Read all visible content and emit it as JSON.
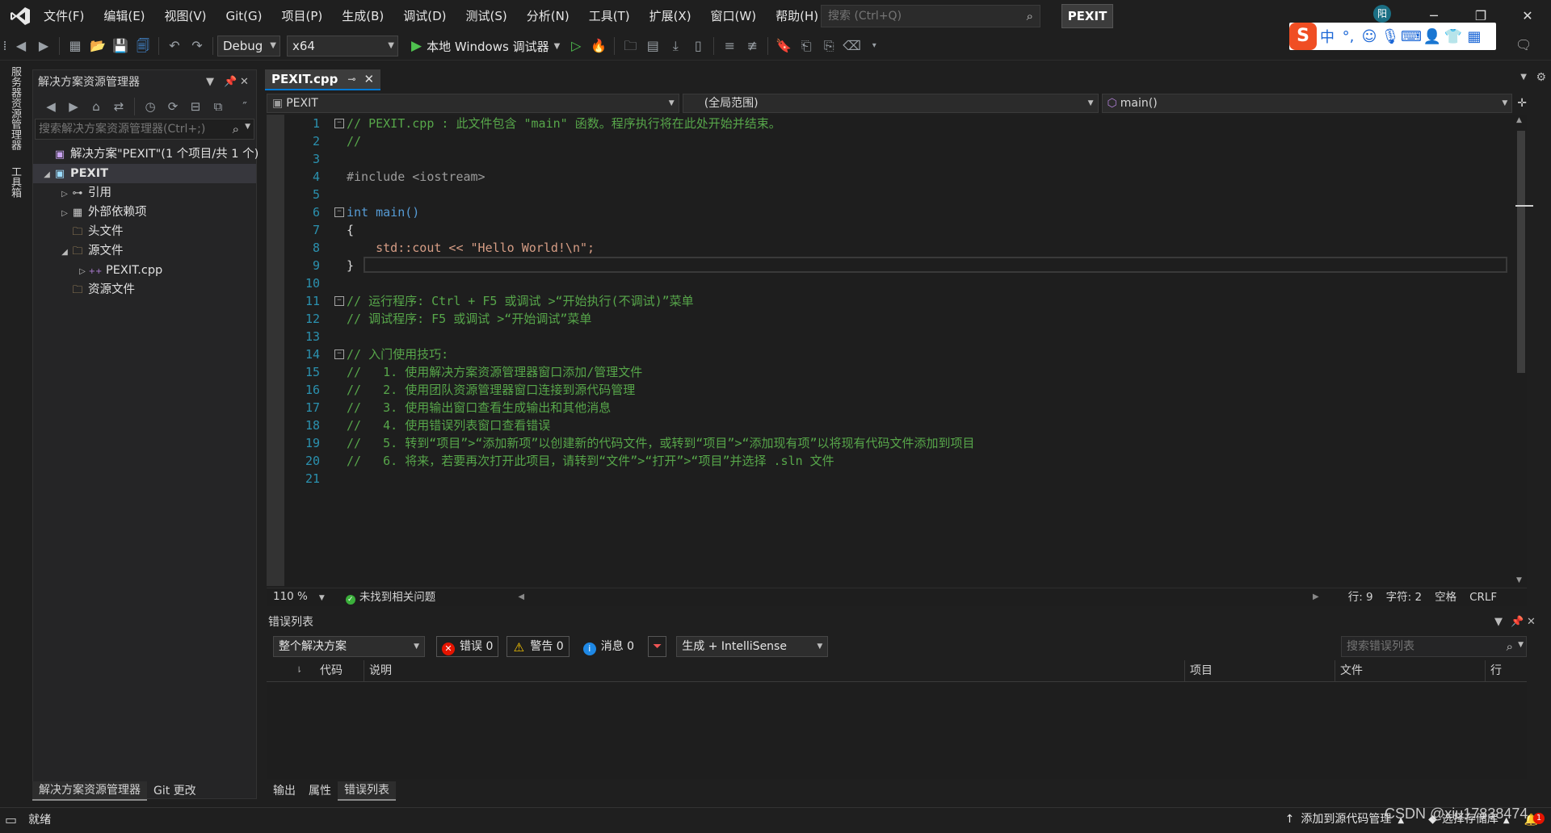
{
  "menu": [
    "文件(F)",
    "编辑(E)",
    "视图(V)",
    "Git(G)",
    "项目(P)",
    "生成(B)",
    "调试(D)",
    "测试(S)",
    "分析(N)",
    "工具(T)",
    "扩展(X)",
    "窗口(W)",
    "帮助(H)"
  ],
  "search": {
    "placeholder": "搜索 (Ctrl+Q)"
  },
  "solution_badge": "PEXIT",
  "account_initial": "阳",
  "toolbar": {
    "config": "Debug",
    "platform": "x64",
    "run_label": "本地 Windows 调试器"
  },
  "ime": {
    "logo": "S",
    "mode": "中",
    "punct": "°,"
  },
  "left_strip": [
    "服务器资源管理器",
    "工具箱"
  ],
  "solution_explorer": {
    "title": "解决方案资源管理器",
    "search_placeholder": "搜索解决方案资源管理器(Ctrl+;)",
    "tree": [
      {
        "label": "解决方案\"PEXIT\"(1 个项目/共 1 个)",
        "level": 0,
        "exp": "",
        "icon": "solution-icon"
      },
      {
        "label": "PEXIT",
        "level": 0,
        "exp": "◢",
        "icon": "project-icon"
      },
      {
        "label": "引用",
        "level": 1,
        "exp": "▷",
        "icon": "reference-icon"
      },
      {
        "label": "外部依赖项",
        "level": 1,
        "exp": "▷",
        "icon": "dependency-icon"
      },
      {
        "label": "头文件",
        "level": 1,
        "exp": "",
        "icon": "folder-icon"
      },
      {
        "label": "源文件",
        "level": 1,
        "exp": "◢",
        "icon": "folder-icon"
      },
      {
        "label": "PEXIT.cpp",
        "level": 2,
        "exp": "▷",
        "icon": "cpp-file-icon"
      },
      {
        "label": "资源文件",
        "level": 1,
        "exp": "",
        "icon": "folder-icon"
      }
    ],
    "bottom_tabs": [
      "解决方案资源管理器",
      "Git 更改"
    ]
  },
  "editor": {
    "tab": "PEXIT.cpp",
    "nav": {
      "project": "PEXIT",
      "scope": "(全局范围)",
      "member": "main()"
    },
    "lines": [
      {
        "n": "1",
        "fold": "⊟",
        "t": "// PEXIT.cpp : 此文件包含 \"main\" 函数。程序执行将在此处开始并结束。",
        "c": "cm"
      },
      {
        "n": "2",
        "fold": "",
        "t": "//",
        "c": "cm"
      },
      {
        "n": "3",
        "fold": "",
        "t": "",
        "c": "txt"
      },
      {
        "n": "4",
        "fold": "",
        "t": "#include <iostream>",
        "c": "pp"
      },
      {
        "n": "5",
        "fold": "",
        "t": "",
        "c": "txt"
      },
      {
        "n": "6",
        "fold": "⊟",
        "t": "int main()",
        "c": "mix-main"
      },
      {
        "n": "7",
        "fold": "",
        "t": "{",
        "c": "txt"
      },
      {
        "n": "8",
        "fold": "",
        "t": "    std::cout << \"Hello World!\\n\";",
        "c": "mix-cout"
      },
      {
        "n": "9",
        "fold": "",
        "t": "}",
        "c": "txt"
      },
      {
        "n": "10",
        "fold": "",
        "t": "",
        "c": "txt"
      },
      {
        "n": "11",
        "fold": "⊟",
        "t": "// 运行程序: Ctrl + F5 或调试 >“开始执行(不调试)”菜单",
        "c": "cm"
      },
      {
        "n": "12",
        "fold": "",
        "t": "// 调试程序: F5 或调试 >“开始调试”菜单",
        "c": "cm"
      },
      {
        "n": "13",
        "fold": "",
        "t": "",
        "c": "txt"
      },
      {
        "n": "14",
        "fold": "⊟",
        "t": "// 入门使用技巧:",
        "c": "cm"
      },
      {
        "n": "15",
        "fold": "",
        "t": "//   1. 使用解决方案资源管理器窗口添加/管理文件",
        "c": "cm"
      },
      {
        "n": "16",
        "fold": "",
        "t": "//   2. 使用团队资源管理器窗口连接到源代码管理",
        "c": "cm"
      },
      {
        "n": "17",
        "fold": "",
        "t": "//   3. 使用输出窗口查看生成输出和其他消息",
        "c": "cm"
      },
      {
        "n": "18",
        "fold": "",
        "t": "//   4. 使用错误列表窗口查看错误",
        "c": "cm"
      },
      {
        "n": "19",
        "fold": "",
        "t": "//   5. 转到“项目”>“添加新项”以创建新的代码文件，或转到“项目”>“添加现有项”以将现有代码文件添加到项目",
        "c": "cm"
      },
      {
        "n": "20",
        "fold": "",
        "t": "//   6. 将来，若要再次打开此项目，请转到“文件”>“打开”>“项目”并选择 .sln 文件",
        "c": "cm"
      },
      {
        "n": "21",
        "fold": "",
        "t": "",
        "c": "txt"
      }
    ],
    "status": {
      "zoom": "110 %",
      "issues": "未找到相关问题",
      "line": "行: 9",
      "char": "字符: 2",
      "spaces": "空格",
      "eol": "CRLF"
    }
  },
  "error_list": {
    "title": "错误列表",
    "scope": "整个解决方案",
    "errors": "错误 0",
    "warnings": "警告 0",
    "messages": "消息 0",
    "build_filter": "生成 + IntelliSense",
    "search_placeholder": "搜索错误列表",
    "columns": [
      "代码",
      "说明",
      "项目",
      "文件",
      "行"
    ]
  },
  "bottom_tabs": [
    "输出",
    "属性",
    "错误列表"
  ],
  "statusbar": {
    "ready": "就绪",
    "source_control": "添加到源代码管理",
    "repo": "选择存储库",
    "notifications": "1"
  },
  "watermark": "CSDN @xiu17838474",
  "colors": {
    "accent": "#0078d4",
    "comment": "#57a64a",
    "keyword": "#569cd6",
    "string": "#d69d85",
    "line_number": "#2b91af"
  }
}
